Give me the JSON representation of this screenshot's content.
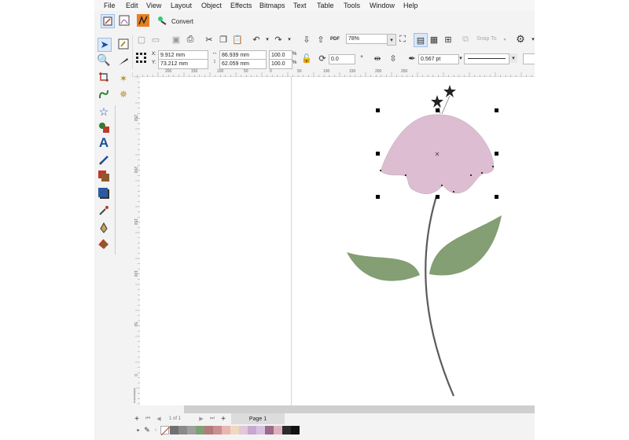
{
  "menu": [
    "File",
    "Edit",
    "View",
    "Layout",
    "Object",
    "Effects",
    "Bitmaps",
    "Text",
    "Table",
    "Tools",
    "Window",
    "Help"
  ],
  "toolbar1": {
    "convert_label": "Convert"
  },
  "toolbar2": {
    "zoom_value": "78%",
    "snap_to_label": "Snap To"
  },
  "props": {
    "x_label": "X:",
    "x_value": "9.912 mm",
    "y_label": "Y:",
    "y_value": "73.212 mm",
    "width_value": "86.939 mm",
    "height_value": "62.059 mm",
    "scale_x": "100.0",
    "scale_y": "100.0",
    "percent": "%",
    "rotation_value": "0.0",
    "outline_width": "0.567 pt"
  },
  "ruler": {
    "h_ticks": [
      "200",
      "150",
      "100",
      "50",
      "0",
      "50",
      "100",
      "150",
      "200",
      "250"
    ],
    "v_ticks": [
      "250",
      "200",
      "150",
      "100",
      "50",
      "0"
    ],
    "v_unit": "millimeters"
  },
  "pagebar": {
    "page_info": "1 of 1",
    "page_tab": "Page 1"
  },
  "palette": [
    "#707070",
    "#8a8a8a",
    "#a0a0a0",
    "#7f9f75",
    "#b47a7a",
    "#c99090",
    "#e6b8b0",
    "#f0d8c0",
    "#e0c8d8",
    "#c7a8d0",
    "#d8c0e0",
    "#9a6a8a",
    "#e0b0c0",
    "#2b2b2b",
    "#111111"
  ],
  "colors": {
    "petal": "#ddbdd2",
    "leaf": "#839f73",
    "stem": "#5b5b5b"
  }
}
